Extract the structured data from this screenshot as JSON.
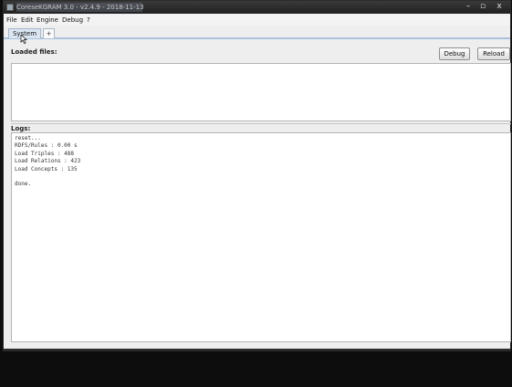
{
  "window": {
    "title": "CoreseKGRAM 3.0 - v2.4.9 - 2018-11-13",
    "controls": {
      "minimize": "–",
      "maximize": "▫",
      "close": "x"
    }
  },
  "menu": [
    {
      "label": "File"
    },
    {
      "label": "Edit"
    },
    {
      "label": "Engine"
    },
    {
      "label": "Debug"
    },
    {
      "label": "?"
    }
  ],
  "tabs": [
    {
      "label": "System"
    },
    {
      "label": "+"
    }
  ],
  "loaded_files": {
    "label": "Loaded files:"
  },
  "buttons": {
    "debug": "Debug",
    "reload": "Reload"
  },
  "logs": {
    "label": "Logs:",
    "lines": [
      "reset...",
      "RDFS/Rules : 0.00 s",
      "Load Triples : 488",
      "Load Relations : 423",
      "Load Concepts : 135",
      "",
      "done."
    ]
  }
}
